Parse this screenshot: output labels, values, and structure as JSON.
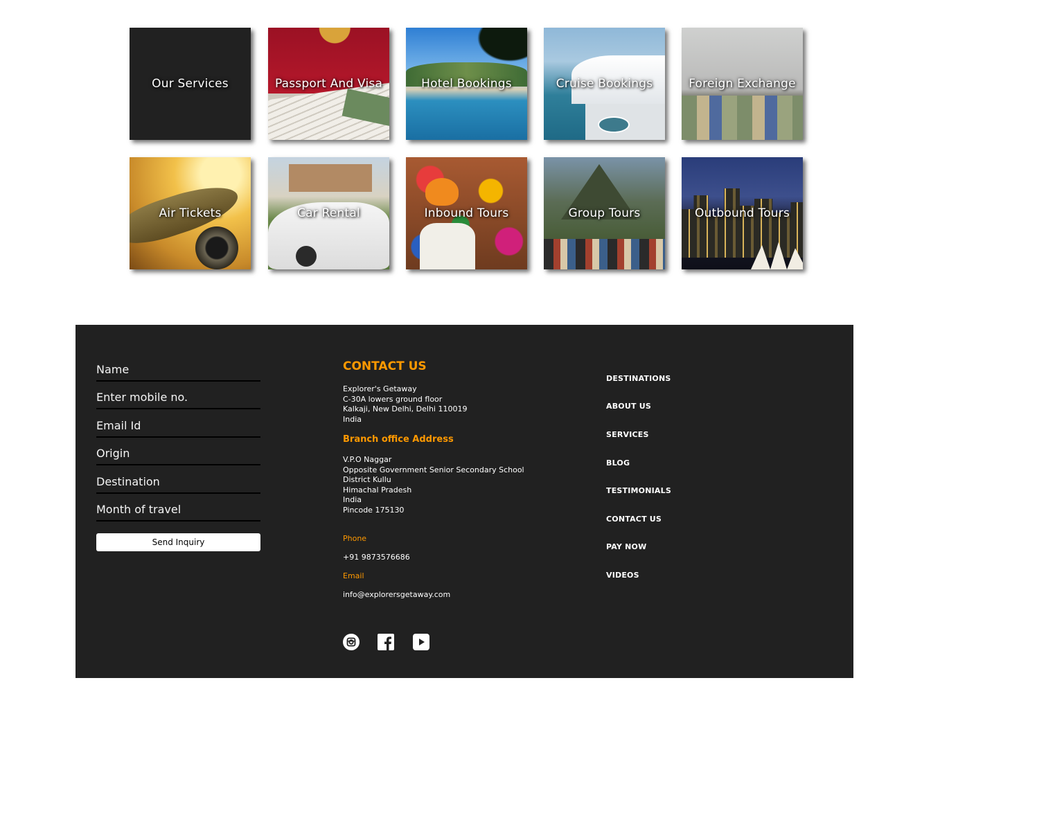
{
  "services": {
    "heading": "Our Services",
    "tiles": [
      {
        "label": "Passport And Visa"
      },
      {
        "label": "Hotel Bookings"
      },
      {
        "label": "Cruise Bookings"
      },
      {
        "label": "Foreign Exchange"
      },
      {
        "label": "Air Tickets"
      },
      {
        "label": "Car Rental"
      },
      {
        "label": "Inbound Tours"
      },
      {
        "label": "Group Tours"
      },
      {
        "label": "Outbound Tours"
      }
    ]
  },
  "inquiry_form": {
    "fields": [
      {
        "placeholder": "Name"
      },
      {
        "placeholder": "Enter mobile no."
      },
      {
        "placeholder": "Email Id"
      },
      {
        "placeholder": "Origin"
      },
      {
        "placeholder": "Destination"
      },
      {
        "placeholder": "Month of travel"
      }
    ],
    "submit_label": "Send Inquiry"
  },
  "contact": {
    "heading": "CONTACT US",
    "hq_address": [
      "Explorer's Getaway",
      "C-30A lowers ground floor",
      "Kalkaji, New Delhi, Delhi 110019",
      "India"
    ],
    "branch_heading": "Branch office Address",
    "branch_address": [
      "V.P.O Naggar",
      "Opposite Government Senior Secondary School",
      "District Kullu",
      "Himachal Pradesh",
      "India",
      "Pincode 175130"
    ],
    "phone_label": "Phone",
    "phone": "+91 9873576686",
    "email_label": "Email",
    "email": "info@explorersgetaway.com"
  },
  "social_icons": [
    "instagram-icon",
    "facebook-icon",
    "youtube-icon"
  ],
  "footer_nav": [
    {
      "label": "DESTINATIONS"
    },
    {
      "label": "ABOUT US"
    },
    {
      "label": "SERVICES"
    },
    {
      "label": "BLOG"
    },
    {
      "label": "TESTIMONIALS"
    },
    {
      "label": "CONTACT US"
    },
    {
      "label": "PAY NOW"
    },
    {
      "label": "VIDEOS"
    }
  ],
  "colors": {
    "footer_bg": "#212121",
    "accent": "#ff9900",
    "tile_dark": "#212121"
  }
}
